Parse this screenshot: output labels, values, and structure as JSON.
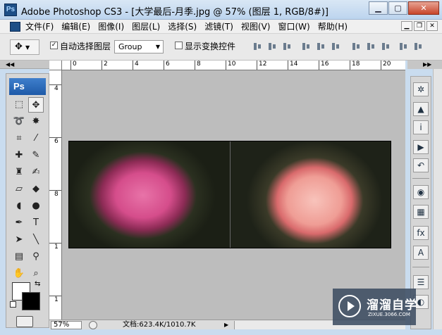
{
  "window": {
    "app_icon": "Ps",
    "title": "Adobe Photoshop CS3 - [大学最后-月季.jpg @ 57% (图层 1, RGB/8#)]",
    "controls": [
      "minimize-icon",
      "maximize-icon",
      "close-icon"
    ]
  },
  "menubar": {
    "items": [
      "文件(F)",
      "编辑(E)",
      "图像(I)",
      "图层(L)",
      "选择(S)",
      "滤镜(T)",
      "视图(V)",
      "窗口(W)",
      "帮助(H)"
    ]
  },
  "options": {
    "tool_icon": "move-tool-icon",
    "auto_select_checked": true,
    "auto_select_label": "自动选择图层",
    "auto_select_mode": "Group",
    "show_transform_checked": false,
    "show_transform_label": "显示变换控件"
  },
  "toolbox": {
    "logo": "Ps",
    "tools": [
      {
        "name": "marquee-tool-icon",
        "glyph": "⬚"
      },
      {
        "name": "move-tool-icon",
        "glyph": "✥",
        "active": true
      },
      {
        "name": "lasso-tool-icon",
        "glyph": "➰"
      },
      {
        "name": "magic-wand-tool-icon",
        "glyph": "✸"
      },
      {
        "name": "crop-tool-icon",
        "glyph": "⌗"
      },
      {
        "name": "slice-tool-icon",
        "glyph": "⁄"
      },
      {
        "name": "healing-brush-tool-icon",
        "glyph": "✚"
      },
      {
        "name": "brush-tool-icon",
        "glyph": "✎"
      },
      {
        "name": "clone-stamp-tool-icon",
        "glyph": "♜"
      },
      {
        "name": "history-brush-tool-icon",
        "glyph": "✍"
      },
      {
        "name": "eraser-tool-icon",
        "glyph": "▱"
      },
      {
        "name": "paint-bucket-tool-icon",
        "glyph": "◆"
      },
      {
        "name": "blur-tool-icon",
        "glyph": "◖"
      },
      {
        "name": "dodge-tool-icon",
        "glyph": "●"
      },
      {
        "name": "pen-tool-icon",
        "glyph": "✒"
      },
      {
        "name": "type-tool-icon",
        "glyph": "T"
      },
      {
        "name": "path-selection-tool-icon",
        "glyph": "➤"
      },
      {
        "name": "line-tool-icon",
        "glyph": "╲"
      },
      {
        "name": "notes-tool-icon",
        "glyph": "▤"
      },
      {
        "name": "eyedropper-tool-icon",
        "glyph": "⚲"
      },
      {
        "name": "hand-tool-icon",
        "glyph": "✋"
      },
      {
        "name": "zoom-tool-icon",
        "glyph": "⌕"
      }
    ],
    "foreground_color": "#ffffff",
    "background_color": "#000000"
  },
  "document": {
    "ruler_h_labels": [
      "0",
      "2",
      "4",
      "6",
      "8",
      "10",
      "12",
      "14",
      "16",
      "18",
      "20"
    ],
    "ruler_v_labels": [
      "4",
      "6",
      "8",
      "1",
      "1"
    ],
    "zoom": "57%",
    "doc_info": "文档:623.4K/1010.7K",
    "images": [
      "pink-rose-with-dew-photo",
      "peach-rose-photo"
    ]
  },
  "right_panel": {
    "icons": [
      "navigator-icon",
      "histogram-icon",
      "info-icon",
      "actions-icon",
      "history-icon",
      "swatches-icon",
      "color-grid-icon",
      "styles-fx-icon",
      "character-icon",
      "layers-icon",
      "channels-icon"
    ]
  },
  "watermark": {
    "text": "溜溜自学",
    "url": "ZIXUE.3066.COM"
  }
}
